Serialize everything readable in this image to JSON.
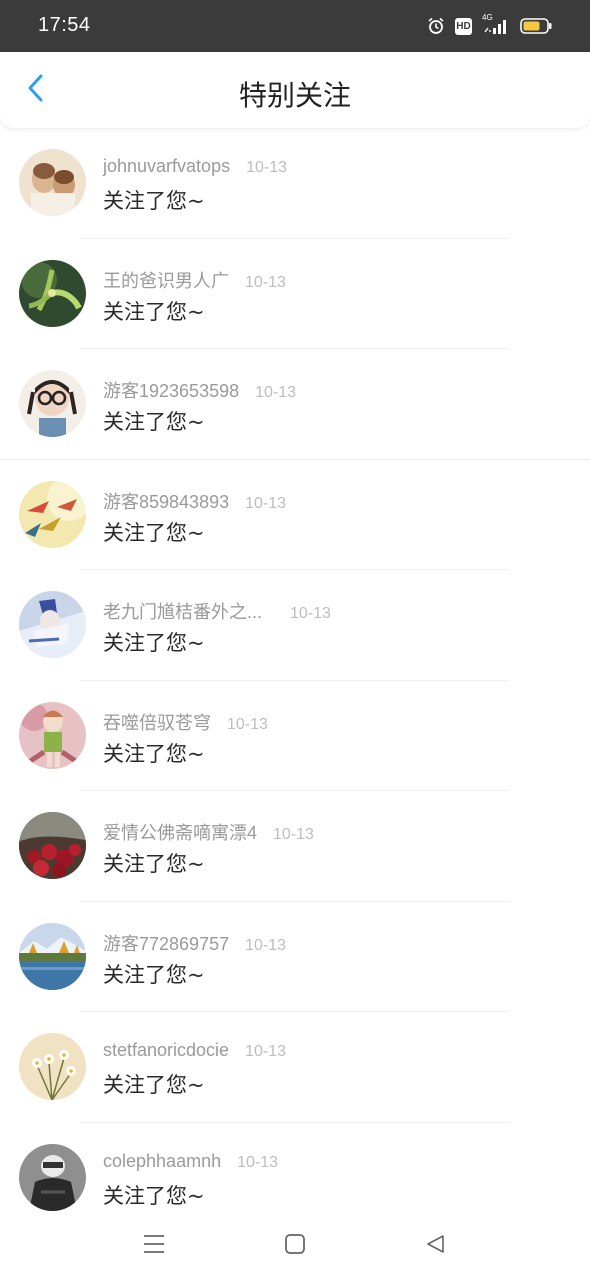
{
  "status_bar": {
    "time": "17:54",
    "icons": [
      "alarm-icon",
      "hd-icon",
      "4g-signal-icon",
      "battery-icon"
    ],
    "hd_label": "HD",
    "network_label": "4G"
  },
  "header": {
    "title": "特别关注",
    "back_icon": "chevron-left-icon",
    "back_color": "#2aa0ee"
  },
  "list": {
    "items": [
      {
        "name": "johnuvarfvatops",
        "date": "10-13",
        "message": "关注了您~"
      },
      {
        "name": "王的爸识男人广",
        "date": "10-13",
        "message": "关注了您~"
      },
      {
        "name": "游客1923653598",
        "date": "10-13",
        "message": "关注了您~"
      },
      {
        "name": "游客859843893",
        "date": "10-13",
        "message": "关注了您~"
      },
      {
        "name": "老九门馗桔番外之...",
        "date": "10-13",
        "message": "关注了您~"
      },
      {
        "name": "吞噬倍驭苍穹",
        "date": "10-13",
        "message": "关注了您~"
      },
      {
        "name": "爱情公佛斋嘀寓漂4",
        "date": "10-13",
        "message": "关注了您~"
      },
      {
        "name": "游客772869757",
        "date": "10-13",
        "message": "关注了您~"
      },
      {
        "name": "stetfanoricdocie",
        "date": "10-13",
        "message": "关注了您~"
      },
      {
        "name": "colephhaamnh",
        "date": "10-13",
        "message": "关注了您~"
      }
    ]
  },
  "nav_bar": {
    "icons": [
      "menu-icon",
      "home-icon",
      "back-triangle-icon"
    ]
  }
}
